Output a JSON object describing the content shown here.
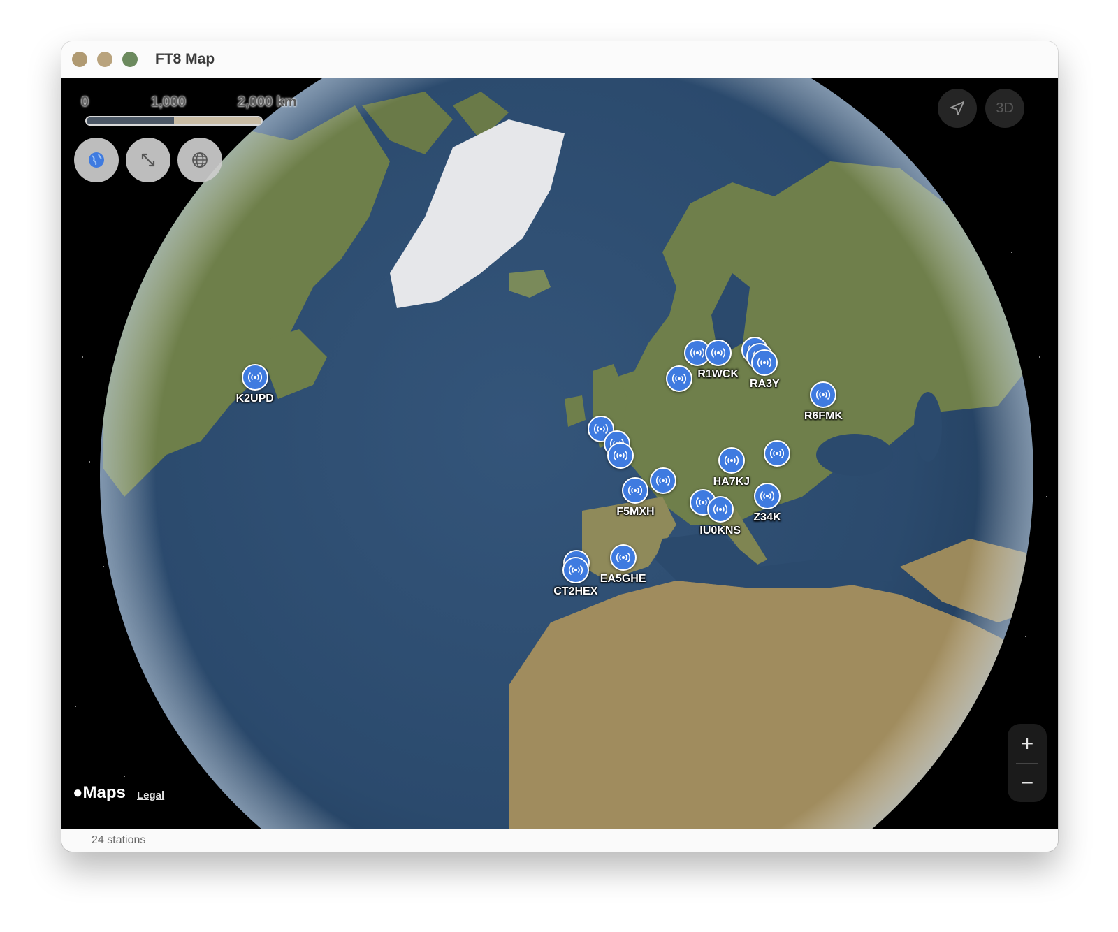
{
  "window": {
    "title": "FT8 Map"
  },
  "scale": {
    "labels": [
      "0",
      "1,000",
      "2,000 km"
    ]
  },
  "controls": {
    "globe_icon": "globe-filled-icon",
    "expand_icon": "expand-arrows-icon",
    "network_icon": "globe-grid-icon",
    "locate_icon": "location-arrow-icon",
    "mode_3d_label": "3D",
    "zoom_in_label": "+",
    "zoom_out_label": "−"
  },
  "attribution": {
    "logo": "Maps",
    "legal_label": "Legal"
  },
  "stations": [
    {
      "label": "K2UPD",
      "lat": 43.0,
      "lon": -76.0
    },
    {
      "label": "",
      "lat": 59.3,
      "lon": 18.1
    },
    {
      "label": "",
      "lat": 61.2,
      "lon": 25.5
    },
    {
      "label": "R1WCK",
      "lat": 59.9,
      "lon": 30.3
    },
    {
      "label": "",
      "lat": 57.5,
      "lon": 38.5
    },
    {
      "label": "",
      "lat": 56.5,
      "lon": 38.5
    },
    {
      "label": "RA3Y",
      "lat": 55.5,
      "lon": 38.5
    },
    {
      "label": "R6FMK",
      "lat": 47.5,
      "lon": 44.5
    },
    {
      "label": "",
      "lat": 55.5,
      "lon": -2.5
    },
    {
      "label": "",
      "lat": 53.5,
      "lon": 0.5
    },
    {
      "label": "",
      "lat": 52.0,
      "lon": 0.8
    },
    {
      "label": "F5MXH",
      "lat": 47.5,
      "lon": 2.6
    },
    {
      "label": "",
      "lat": 48.0,
      "lon": 8.0
    },
    {
      "label": "HA7KJ",
      "lat": 47.5,
      "lon": 21.5
    },
    {
      "label": "",
      "lat": 45.5,
      "lon": 30.0
    },
    {
      "label": "",
      "lat": 44.0,
      "lon": 14.0
    },
    {
      "label": "IU0KNS",
      "lat": 42.5,
      "lon": 16.5
    },
    {
      "label": "Z34K",
      "lat": 41.5,
      "lon": 25.0
    },
    {
      "label": "EA5GHE",
      "lat": 39.5,
      "lon": -1.0
    },
    {
      "label": "",
      "lat": 39.2,
      "lon": -8.5
    },
    {
      "label": "CT2HEX",
      "lat": 38.3,
      "lon": -8.6
    }
  ],
  "status": {
    "count_text": "24 stations"
  }
}
